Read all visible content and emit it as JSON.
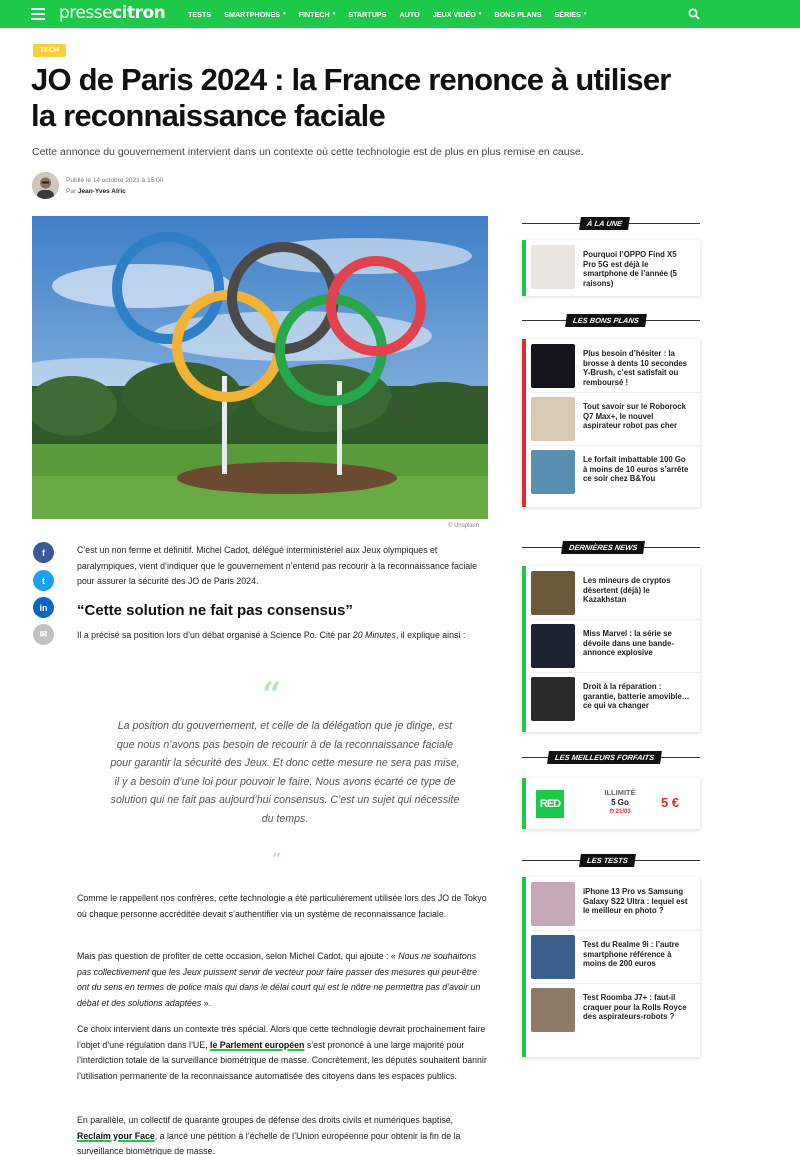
{
  "nav": {
    "logo_a": "presse",
    "logo_b": "citron",
    "items": [
      {
        "label": "TESTS",
        "dropdown": false
      },
      {
        "label": "SMARTPHONES",
        "dropdown": true
      },
      {
        "label": "FINTECH",
        "dropdown": true
      },
      {
        "label": "STARTUPS",
        "dropdown": false
      },
      {
        "label": "AUTO",
        "dropdown": false
      },
      {
        "label": "JEUX VIDÉO",
        "dropdown": true
      },
      {
        "label": "BONS PLANS",
        "dropdown": false
      },
      {
        "label": "SÉRIES",
        "dropdown": true
      }
    ],
    "icons": [
      "menu-icon",
      "search-icon"
    ]
  },
  "article": {
    "tag": "TECH",
    "title": "JO de Paris 2024 : la France renonce à utiliser la reconnaissance faciale",
    "subtitle": "Cette annonce du gouvernement intervient dans un contexte où cette technologie est de plus en plus remise en cause.",
    "published": "Publié le 14 octobre 2021 à 15:00",
    "by_prefix": "Par ",
    "author": "Jean-Yves Alric",
    "image_credit": "© Unsplash",
    "p1": "C’est un non ferme et définitif. Michel Cadot, délégué interministériel aux Jeux olympiques et paralympiques, vient d’indiquer que le gouvernement n’entend pas recourir à la reconnaissance faciale pour assurer la sécurité des JO de Paris 2024.",
    "h2": "“Cette solution ne fait pas consensus”",
    "p2_a": "Il a précisé sa position lors d’un débat organisé à Science Po. Cité par ",
    "p2_em": "20 Minutes",
    "p2_b": ", il explique ainsi :",
    "quote_open": "“",
    "quote": "La position du gouvernement, et celle de la délégation que je dirige, est que nous n’avons pas besoin de recourir à de la reconnaissance faciale pour garantir la sécurité des Jeux. Et donc cette mesure ne sera pas mise, il y a besoin d’une loi pour pouvoir le faire. Nous avons écarté ce type de solution qui ne fait pas aujourd’hui consensus. C’est un sujet qui nécessite du temps.",
    "quote_close": "”",
    "p3": "Comme le rappellent nos confrères, cette technologie a été particulièrement utilisée lors des JO de Tokyo où chaque personne accréditée devait s’authentifier via un système de reconnaissance faciale.",
    "p4_a": "Mais pas question de profiter de cette occasion, selon Michel Cadot, qui ajoute : « ",
    "p4_em": "Nous ne souhaitons pas collectivement que les Jeux puissent servir de vecteur pour faire passer des mesures qui peut-être ont du sens en termes de police mais qui dans le délai court qui est le nôtre ne permettra pas d’avoir un débat et des solutions adaptées",
    "p4_b": " ».",
    "p5_a": "Ce choix intervient dans un contexte très spécial. Alors que cette technologie devrait prochainement faire l’objet d’une régulation dans l’UE, ",
    "p5_link": "le Parlement européen",
    "p5_b": " s’est prononcé à une large majorité pour l’interdiction totale de la surveillance biométrique de masse. Concrètement, les députés souhaitent bannir l’utilisation permanente de la reconnaissance automatisée des citoyens dans les espaces publics.",
    "p6_a": "En parallèle, un collectif de quarante groupes de défense des droits civils et numériques baptisé, ",
    "p6_link": "Reclaim your Face",
    "p6_b": ", a lancé une pétition à l’échelle de l’Union européenne pour obtenir la fin de la surveillance biométrique de masse."
  },
  "share": [
    {
      "name": "facebook-share-button",
      "glyph": "f",
      "color": "#3b5998"
    },
    {
      "name": "twitter-share-button",
      "glyph": "t",
      "color": "#1da1f2"
    },
    {
      "name": "linkedin-share-button",
      "glyph": "in",
      "color": "#0a66c2"
    },
    {
      "name": "email-share-button",
      "glyph": "✉",
      "color": "#c2c2c2"
    }
  ],
  "sidebar": {
    "a_la_une": {
      "label": "À LA UNE",
      "accent": "#1ec94a",
      "items": [
        {
          "title": "Pourquoi l’OPPO Find X5 Pro 5G est déjà le smartphone de l’année (5 raisons)",
          "thumb": "#e9e6e2"
        }
      ]
    },
    "bons_plans": {
      "label": "LES BONS PLANS",
      "accent": "#e32b2b",
      "items": [
        {
          "title": "Plus besoin d’hésiter : la brosse à dents 10 secondes Y-Brush, c’est satisfait ou remboursé !",
          "thumb": "#14141c"
        },
        {
          "title": "Tout savoir sur le Roborock Q7 Max+, le nouvel aspirateur robot pas cher",
          "thumb": "#d8c9b3"
        },
        {
          "title": "Le forfait imbattable 100 Go à moins de 10 euros s’arrête ce soir chez B&You",
          "thumb": "#5a8fb0"
        }
      ]
    },
    "news": {
      "label": "DERNIÈRES NEWS",
      "accent": "#1ec94a",
      "items": [
        {
          "title": "Les mineurs de cryptos désertent (déjà) le Kazakhstan",
          "thumb": "#6b5a3a"
        },
        {
          "title": "Miss Marvel : la série se dévoile dans une bande-annonce explosive",
          "thumb": "#1d2233"
        },
        {
          "title": "Droit à la réparation : garantie, batterie amovible… ce qui va changer",
          "thumb": "#2a2a2a"
        }
      ]
    },
    "forfaits": {
      "label": "LES MEILLEURS FORFAITS",
      "accent": "#1ec94a",
      "brand": "RED",
      "brand_color": "#1ec94a",
      "plan": "ILLIMITÉ",
      "data": "5 Go",
      "promo_end": "21/03",
      "price": "5 €"
    },
    "tests": {
      "label": "LES TESTS",
      "accent": "#1ec94a",
      "items": [
        {
          "title": "iPhone 13 Pro vs Samsung Galaxy S22 Ultra : lequel est le meilleur en photo ?",
          "thumb": "#c5a9b8"
        },
        {
          "title": "Test du Realme 9i : l’autre smartphone référence à moins de 200 euros",
          "thumb": "#3a5f8a"
        },
        {
          "title": "Test Roomba J7+ : faut-il craquer pour la Rolls Royce des aspirateurs-robots ?",
          "thumb": "#8c7a66"
        }
      ]
    }
  }
}
